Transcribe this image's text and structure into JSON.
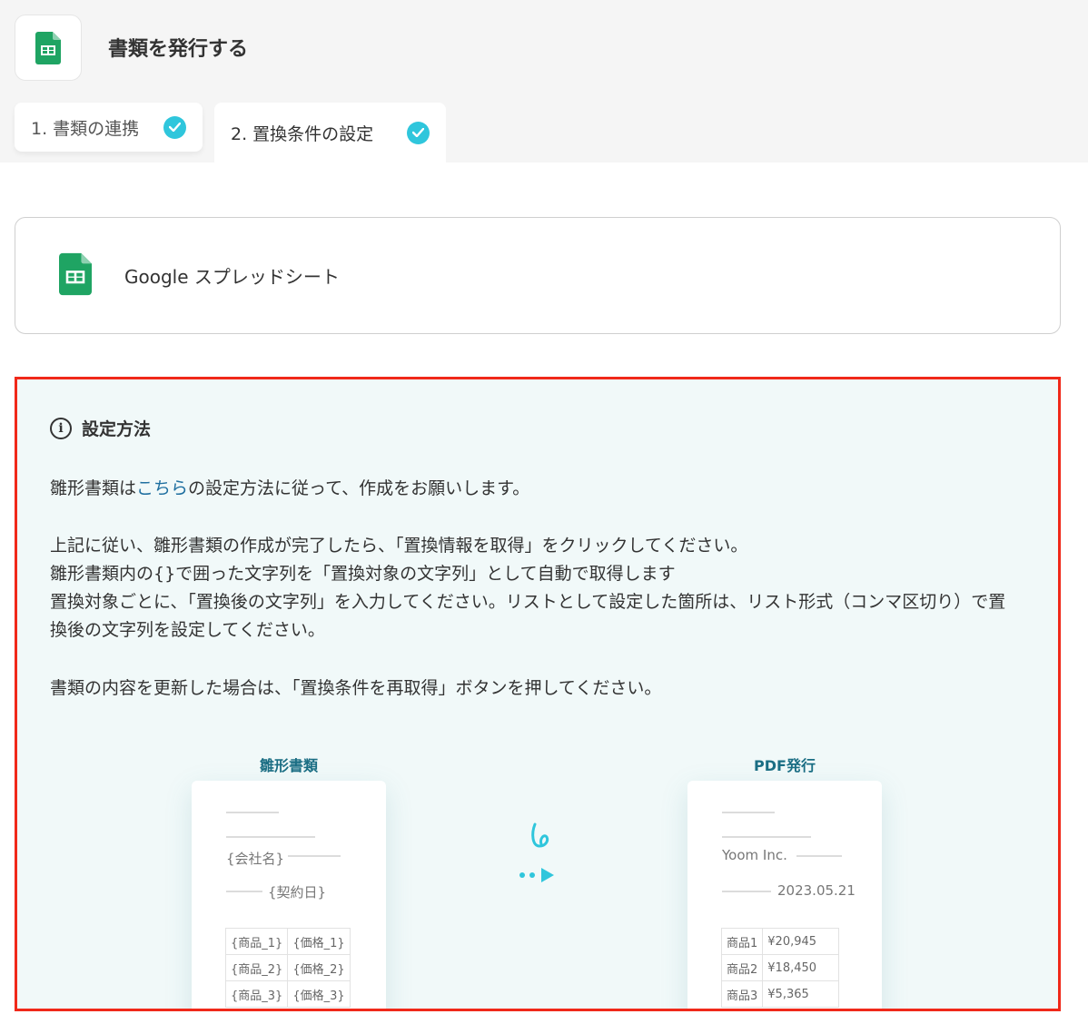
{
  "header": {
    "title": "書類を発行する",
    "app_icon": "google-sheets-icon"
  },
  "tabs": [
    {
      "label": "1. 書類の連携",
      "done": true
    },
    {
      "label": "2. 置換条件の設定",
      "done": true
    }
  ],
  "app_card": {
    "name": "Google スプレッドシート"
  },
  "info": {
    "heading": "設定方法",
    "p1_before": "雛形書類は",
    "p1_link": "こちら",
    "p1_after": "の設定方法に従って、作成をお願いします。",
    "p2_line1": "上記に従い、雛形書類の作成が完了したら、「置換情報を取得」をクリックしてください。",
    "p2_line2": "雛形書類内の{}で囲った文字列を「置換対象の文字列」として自動で取得します",
    "p2_line3": "置換対象ごとに、「置換後の文字列」を入力してください。リストとして設定した箇所は、リスト形式（コンマ区切り）で置",
    "p2_line4": "換後の文字列を設定してください。",
    "p3": "書類の内容を更新した場合は、「置換条件を再取得」ボタンを押してください。"
  },
  "illustration": {
    "left_label": "雛形書類",
    "right_label": "PDF発行",
    "template": {
      "company": "{会社名}",
      "date": "{契約日}",
      "rows": [
        [
          "{商品_1}",
          "{価格_1}"
        ],
        [
          "{商品_2}",
          "{価格_2}"
        ],
        [
          "{商品_3}",
          "{価格_3}"
        ]
      ]
    },
    "output": {
      "company": "Yoom Inc.",
      "date": "2023.05.21",
      "rows": [
        [
          "商品1",
          "¥20,945"
        ],
        [
          "商品2",
          "¥18,450"
        ],
        [
          "商品3",
          "¥5,365"
        ]
      ]
    }
  }
}
